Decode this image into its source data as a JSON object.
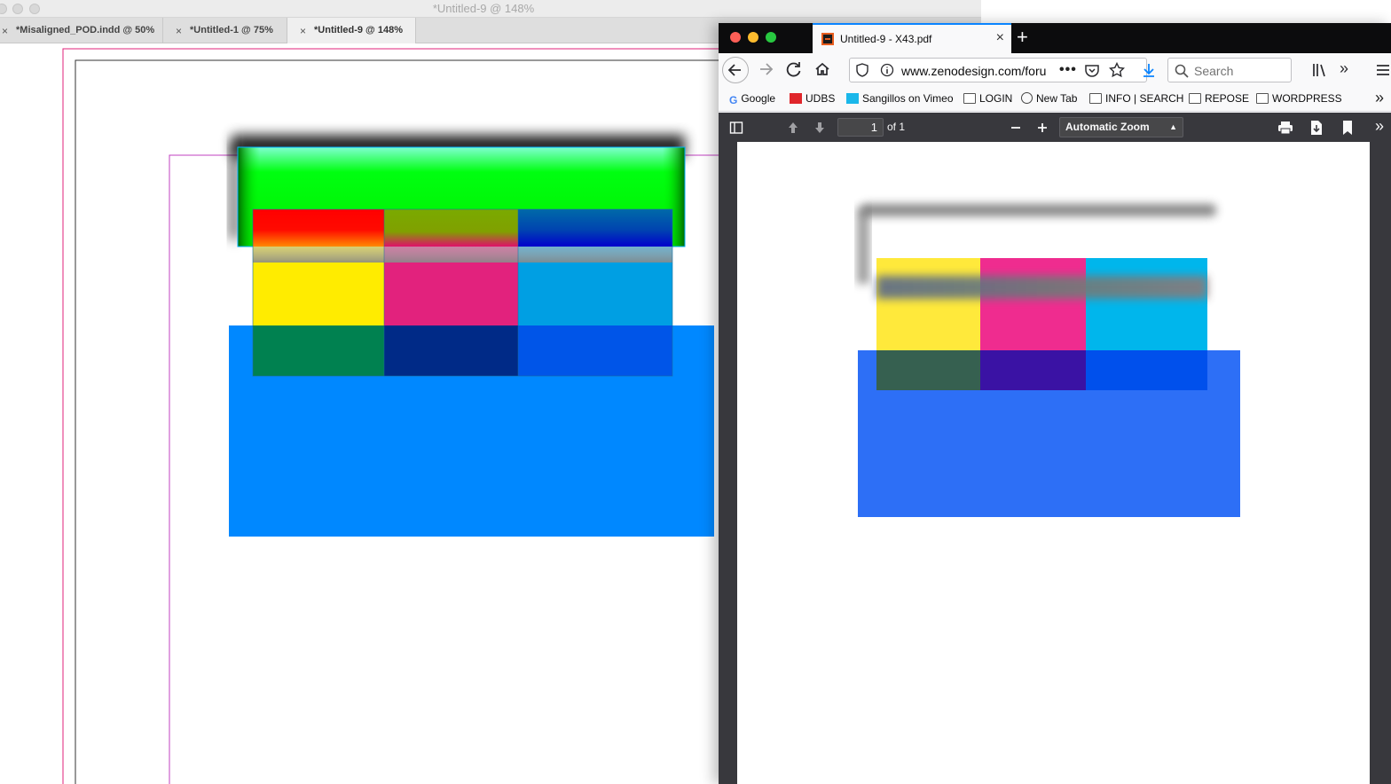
{
  "indesign": {
    "window_title": "*Untitled-9 @ 148%",
    "tabs": [
      {
        "label": "*Misaligned_POD.indd @ 50%",
        "close": "×"
      },
      {
        "label": "*Untitled-1 @ 75%",
        "close": "×"
      },
      {
        "label": "*Untitled-9 @ 148%",
        "close": "×"
      }
    ]
  },
  "firefox": {
    "tab_title": "Untitled-9 - X43.pdf",
    "tab_close": "×",
    "new_tab": "+",
    "url": "www.zenodesign.com/foru",
    "search_placeholder": "Search",
    "bookmarks": [
      {
        "label": "Google",
        "icon": "google-icon"
      },
      {
        "label": "UDBS",
        "icon": "udbs-icon"
      },
      {
        "label": "Sangillos on Vimeo",
        "icon": "vimeo-icon"
      },
      {
        "label": "LOGIN",
        "icon": "folder-icon"
      },
      {
        "label": "New Tab",
        "icon": "globe-icon"
      },
      {
        "label": "INFO | SEARCH",
        "icon": "folder-icon"
      },
      {
        "label": "REPOSE",
        "icon": "folder-icon"
      },
      {
        "label": "WORDPRESS",
        "icon": "folder-icon"
      }
    ],
    "pdf_toolbar": {
      "page_number": "1",
      "page_count": "of 1",
      "zoom": "Automatic Zoom"
    }
  },
  "colors": {
    "indesign_margin_guide": "#c040c0",
    "indesign_bleed_guide": "#e0207a",
    "ff_accent": "#0a84ff",
    "pdf_toolbar_bg": "#38383d"
  }
}
